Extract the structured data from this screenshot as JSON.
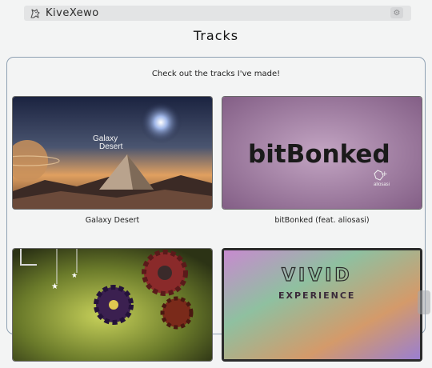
{
  "header": {
    "brand_name": "KiveXewo",
    "brand_icon": "dragon-icon",
    "settings_icon": "gear-icon"
  },
  "page": {
    "title": "Tracks",
    "intro": "Check out the tracks I've made!"
  },
  "tracks": [
    {
      "title": "Galaxy Desert",
      "art_text_1": "Galaxy",
      "art_text_2": "Desert"
    },
    {
      "title": "bitBonked (feat. aliosasi)",
      "art_text_1": "bitBonked",
      "art_badge": "aliosasi"
    },
    {
      "title": "",
      "art_text_1": ""
    },
    {
      "title": "",
      "art_text_1": "VIVID",
      "art_text_2": "EXPERIENCE"
    }
  ]
}
